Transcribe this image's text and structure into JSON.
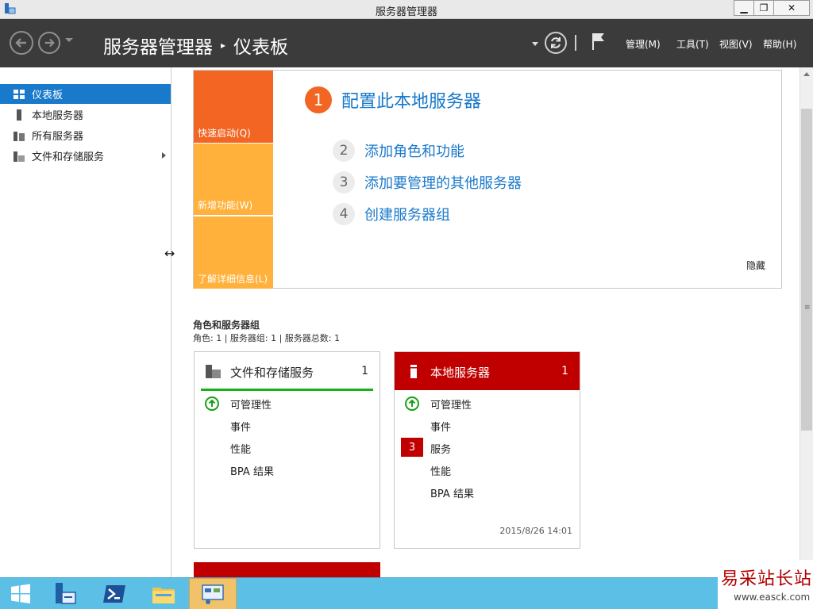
{
  "window": {
    "title": "服务器管理器",
    "minimize": "▁",
    "restore": "❐",
    "close": "✕"
  },
  "header": {
    "breadcrumb_root": "服务器管理器",
    "breadcrumb_sep": "▸",
    "breadcrumb_current": "仪表板",
    "menus": [
      "管理(M)",
      "工具(T)",
      "视图(V)",
      "帮助(H)"
    ]
  },
  "sidebar": {
    "items": [
      {
        "label": "仪表板",
        "icon": "dashboard-icon",
        "active": true
      },
      {
        "label": "本地服务器",
        "icon": "server-icon"
      },
      {
        "label": "所有服务器",
        "icon": "servers-icon"
      },
      {
        "label": "文件和存储服务",
        "icon": "file-storage-icon",
        "has_children": true
      }
    ]
  },
  "quick_start": {
    "tiles": [
      "快速启动(Q)",
      "新增功能(W)",
      "了解详细信息(L)"
    ],
    "steps": [
      {
        "num": "1",
        "label": "配置此本地服务器"
      },
      {
        "num": "2",
        "label": "添加角色和功能"
      },
      {
        "num": "3",
        "label": "添加要管理的其他服务器"
      },
      {
        "num": "4",
        "label": "创建服务器组"
      }
    ],
    "hide_label": "隐藏"
  },
  "roles": {
    "title": "角色和服务器组",
    "summary": "角色: 1 | 服务器组: 1 | 服务器总数: 1",
    "cards": [
      {
        "title": "文件和存储服务",
        "count": "1",
        "rows": [
          "可管理性",
          "事件",
          "性能",
          "BPA 结果"
        ]
      },
      {
        "title": "本地服务器",
        "count": "1",
        "rows": [
          "可管理性",
          "事件",
          "服务",
          "性能",
          "BPA 结果"
        ],
        "services_badge": "3",
        "timestamp": "2015/8/26 14:01"
      }
    ]
  },
  "watermark": {
    "brand": "易采站长站",
    "url": "www.easck.com"
  },
  "colors": {
    "header_bg": "#3b3b3b",
    "accent_blue": "#1979ca",
    "orange": "#f26522",
    "amber": "#ffb13b",
    "alert_red": "#c00000",
    "ok_green": "#18a018",
    "taskbar": "#5cc0e6"
  }
}
